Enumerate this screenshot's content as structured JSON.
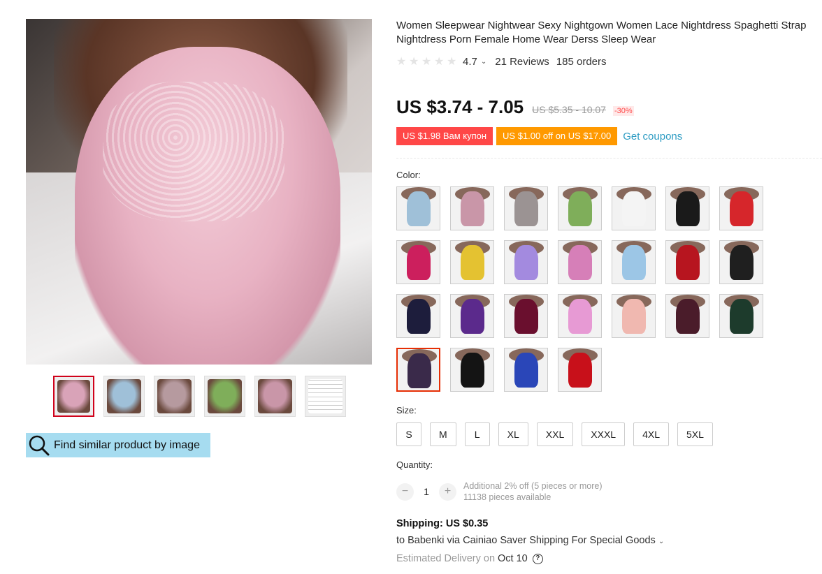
{
  "product": {
    "title": "Women Sleepwear Nightwear Sexy Nightgown Women Lace Nightdress Spaghetti Strap Nightdress Porn Female Home Wear Derss Sleep Wear",
    "rating": "4.7",
    "reviews": "21 Reviews",
    "orders": "185 orders"
  },
  "price": {
    "current": "US $3.74 - 7.05",
    "original": "US $5.35 - 10.07",
    "discount": "-30%"
  },
  "coupons": {
    "coupon_1": "US $1.98 Вам купон",
    "coupon_2": "US $1.00 off on US $17.00",
    "get_coupons": "Get coupons"
  },
  "color": {
    "label": "Color:",
    "swatches": [
      "#9fc0d8",
      "#c996a8",
      "#9b9393",
      "#7fae5a",
      "#f4f4f4",
      "#1a1a1a",
      "#d6262b",
      "#cc1f5d",
      "#e4c231",
      "#a38adf",
      "#d67fb8",
      "#9cc6e6",
      "#b7151f",
      "#1f1f1f",
      "#1d1d3c",
      "#5b2a8c",
      "#6a0f2e",
      "#e79ad4",
      "#f0b8b0",
      "#4a1c2a",
      "#1d3b2c",
      "#3a2a4a",
      "#141414",
      "#2a46b8",
      "#c8101a"
    ],
    "selected_index": 21
  },
  "size": {
    "label": "Size:",
    "options": [
      "S",
      "M",
      "L",
      "XL",
      "XXL",
      "XXXL",
      "4XL",
      "5XL"
    ]
  },
  "quantity": {
    "label": "Quantity:",
    "value": "1",
    "minus": "−",
    "plus": "+",
    "promo": "Additional 2% off (5 pieces or more)",
    "available": "11138 pieces available"
  },
  "shipping": {
    "title": "Shipping: US $0.35",
    "route": "to Babenki via Cainiao Saver Shipping For Special Goods",
    "delivery_prefix": "Estimated Delivery on",
    "delivery_date": "Oct 10"
  },
  "gallery": {
    "thumb_colors": [
      "#d9a3b8",
      "#9fc0d8",
      "#b69a9f",
      "#7fae5a",
      "#c996a8"
    ],
    "find_similar": "Find similar product by image"
  },
  "icons": {
    "chevron": "chevron-down-icon",
    "help": "question-circle-icon",
    "search": "magnifier-icon"
  }
}
